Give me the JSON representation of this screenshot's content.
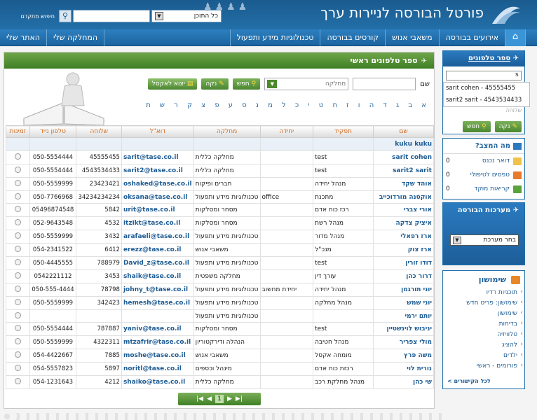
{
  "header": {
    "title": "פורטל הבורסה לניירות ערך",
    "search_label": "חיפוש מתקדם",
    "scope": "כל התוכן"
  },
  "nav": {
    "items": [
      "אירועים בבורסה",
      "משאבי אנוש",
      "קורסים בבורסה",
      "טכנולוגיות מידע ותפעול"
    ],
    "right": [
      "המחלקה שלי",
      "האתר שלי"
    ]
  },
  "main": {
    "title": "ספר טלפונים ראשי",
    "name_label": "שם",
    "dept_label": "מחלקה",
    "search_btn": "חפש",
    "clear_btn": "נקה",
    "export_btn": "יצוא לאקסל",
    "letters": "א ב ג ד ה ו ז ח ט י כ ל מ נ ס ע פ צ ק ר ש ת",
    "columns": [
      "שם",
      "תפקיד",
      "יחידה",
      "מחלקה",
      "דוא\"ל",
      "שלוחה",
      "טלפון נייד",
      "זמינות"
    ],
    "rows": [
      [
        "kuku kuku",
        "",
        "",
        "",
        "",
        "",
        "",
        ""
      ],
      [
        "sarit cohen",
        "test",
        "",
        "מחלקה כללית",
        "sarit@tase.co.il",
        "45555455",
        "050-5554444",
        ""
      ],
      [
        "sarit2 sarit",
        "test",
        "",
        "מחלקה כללית",
        "sarit2@tase.co.il",
        "4543534433",
        "050-5554444",
        ""
      ],
      [
        "אוהד שקד",
        "מנהל יחידה",
        "",
        "חברים ופיקוח",
        "oshaked@tase.co.il",
        "23423421",
        "050-5559999",
        ""
      ],
      [
        "אוקסנה מורדוכייב",
        "מתכנת",
        "office",
        "טכנולוגיות מידע ותפעול",
        "oksana@tase.co.il",
        "34234234234",
        "050-7766968",
        ""
      ],
      [
        "אורי צברי",
        "רכז כוח אדם",
        "",
        "מסחר ומסלקות",
        "urit@tase.co.il",
        "5842",
        "05496874548",
        ""
      ],
      [
        "איציק צדקה",
        "מנהל רשת",
        "",
        "מסחר ומסלקות",
        "itzikt@tase.co.il",
        "4532",
        "052-9643548",
        ""
      ],
      [
        "ארז רפאלי",
        "מנהל מדור",
        "",
        "טכנולוגיות מידע ותפעול",
        "arafaeli@tase.co.il",
        "3432",
        "050-5559999",
        ""
      ],
      [
        "ארז צוק",
        "מנכ\"ל",
        "",
        "משאבי אנוש",
        "erezz@tase.co.il",
        "6412",
        "054-2341522",
        ""
      ],
      [
        "דודו זורין",
        "test",
        "",
        "טכנולוגיות מידע ותפעול",
        "David_z@tase.co.il",
        "788979",
        "050-4445555",
        ""
      ],
      [
        "דרור כהן",
        "עורך דין",
        "",
        "מחלקה משפטית",
        "shaik@tase.co.il",
        "3453",
        "0542221112",
        ""
      ],
      [
        "יוני תורגמן",
        "מנהל יחידה",
        "יחידת מחשוב",
        "טכנולוגיות מידע ותפעול",
        "johny_t@tase.co.il",
        "78798",
        "050-555-4444",
        ""
      ],
      [
        "יוני שמש",
        "מנהל מחלקה",
        "",
        "טכנולוגיות מידע ותפעול",
        "hemesh@tase.co.il",
        "342423",
        "050-5559999",
        ""
      ],
      [
        "יותם ירמי",
        "",
        "",
        "טכנולוגיות מידע ותפעול",
        "",
        "",
        "",
        ""
      ],
      [
        "יניבוש לוינשטיין",
        "test",
        "",
        "מסחר ומסלקות",
        "yaniv@tase.co.il",
        "787887",
        "050-5554444",
        ""
      ],
      [
        "מולי צפריר",
        "מנהל חטיבה",
        "",
        "הנהלה ודירקטוריון",
        "mtzafrir@tase.co.il",
        "4322311",
        "050-5559999",
        ""
      ],
      [
        "משה פרץ",
        "מומחה אקסל",
        "",
        "משאבי אנוש",
        "moshe@tase.co.il",
        "7885",
        "054-4422667",
        ""
      ],
      [
        "נורית לוי",
        "רכזת כוח אדם",
        "",
        "מינהל וכספים",
        "noritl@tase.co.il",
        "5897",
        "054-5557823",
        ""
      ],
      [
        "שי כהן",
        "מנהל מחלקת רכב",
        "",
        "מחלקה כללית",
        "shaiko@tase.co.il",
        "4212",
        "054-1231643",
        ""
      ]
    ],
    "page": "1"
  },
  "sidebar": {
    "phone_title": "ספר טלפונים",
    "phone_value": "s",
    "suggestions": [
      "sarit cohen - 45555455",
      "sarit2 sarit - 4543534433"
    ],
    "ghost": "שלוחה",
    "search_btn": "חפש",
    "clear_btn": "נקה",
    "status_title": "מה המצב?",
    "status": [
      [
        "דואר נכנס",
        "0"
      ],
      [
        "טפסים לטיפולי",
        "0"
      ],
      [
        "קריאות מוקד",
        "0"
      ]
    ],
    "systems_title": "מערכות הבורסה",
    "systems_select": "בחר מערכת",
    "use_title": "שימושון",
    "use_items": [
      "תוכניות רדיו",
      "שימושון: פריט חדש",
      "שימושון",
      "בדיחות",
      "טלוויזיה",
      "להציג",
      "ילדים",
      "פורומים - ראשי"
    ],
    "use_footer": "לכל הקישורים >"
  }
}
